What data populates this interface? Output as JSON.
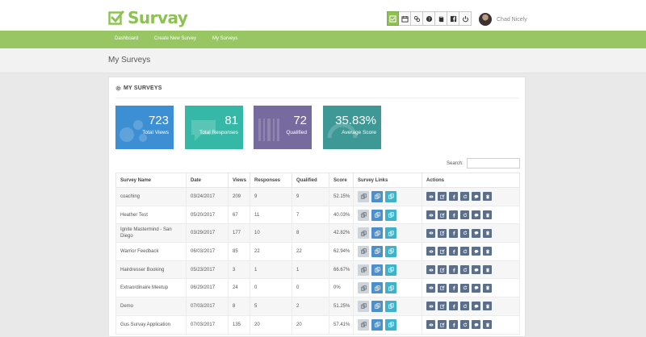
{
  "app": {
    "name": "Survay"
  },
  "colors": {
    "brand_green": "#8dc152",
    "nav_green": "#98c663",
    "stat_blue": "#3d8fd4",
    "stat_teal": "#36b8a7",
    "stat_purple": "#776a9e",
    "stat_cyan": "#3d9896",
    "action_blue": "#5b6e8a"
  },
  "toolbar": {
    "icons": [
      "checkbox-icon",
      "calendar-icon",
      "link-icon",
      "help-icon",
      "book-icon",
      "facebook-icon",
      "power-icon"
    ]
  },
  "user": {
    "name": "Chad Nicely"
  },
  "nav": {
    "items": [
      "Dashboard",
      "Create New Survey",
      "My Surveys"
    ]
  },
  "page": {
    "title": "My Surveys"
  },
  "panel": {
    "title": "MY SURVEYS"
  },
  "stats": [
    {
      "value": "723",
      "label": "Total Views"
    },
    {
      "value": "81",
      "label": "Total Responses"
    },
    {
      "value": "72",
      "label": "Qualified"
    },
    {
      "value": "35.83%",
      "label": "Average Score"
    }
  ],
  "search": {
    "label": "Search:",
    "value": "",
    "placeholder": ""
  },
  "table": {
    "columns": [
      "Survey Name",
      "Date",
      "Views",
      "Responses",
      "Qualified",
      "Score",
      "Survey Links",
      "Actions"
    ],
    "rows": [
      {
        "name": "coaching",
        "date": "03/24/2017",
        "views": "209",
        "responses": "9",
        "qualified": "9",
        "score": "52.15%"
      },
      {
        "name": "Heather Test",
        "date": "05/20/2017",
        "views": "67",
        "responses": "11",
        "qualified": "7",
        "score": "40.03%"
      },
      {
        "name": "Ignite Mastermind - San Diego",
        "date": "03/29/2017",
        "views": "177",
        "responses": "10",
        "qualified": "8",
        "score": "42.82%"
      },
      {
        "name": "Warrior Feedback",
        "date": "06/03/2017",
        "views": "85",
        "responses": "22",
        "qualified": "22",
        "score": "62.94%"
      },
      {
        "name": "Hairdresser Booking",
        "date": "05/23/2017",
        "views": "3",
        "responses": "1",
        "qualified": "1",
        "score": "66.67%"
      },
      {
        "name": "Extraordinaire Meetup",
        "date": "06/29/2017",
        "views": "24",
        "responses": "0",
        "qualified": "0",
        "score": "0%"
      },
      {
        "name": "Demo",
        "date": "07/03/2017",
        "views": "8",
        "responses": "5",
        "qualified": "2",
        "score": "51.25%"
      },
      {
        "name": "Gus Survay Application",
        "date": "07/03/2017",
        "views": "135",
        "responses": "20",
        "qualified": "20",
        "score": "57.41%"
      }
    ],
    "link_icons": [
      "copy-link-icon",
      "copy-link-icon",
      "copy-link-icon"
    ],
    "action_icons": [
      "view-icon",
      "edit-icon",
      "facebook-icon",
      "refresh-icon",
      "comment-icon",
      "delete-icon"
    ]
  }
}
